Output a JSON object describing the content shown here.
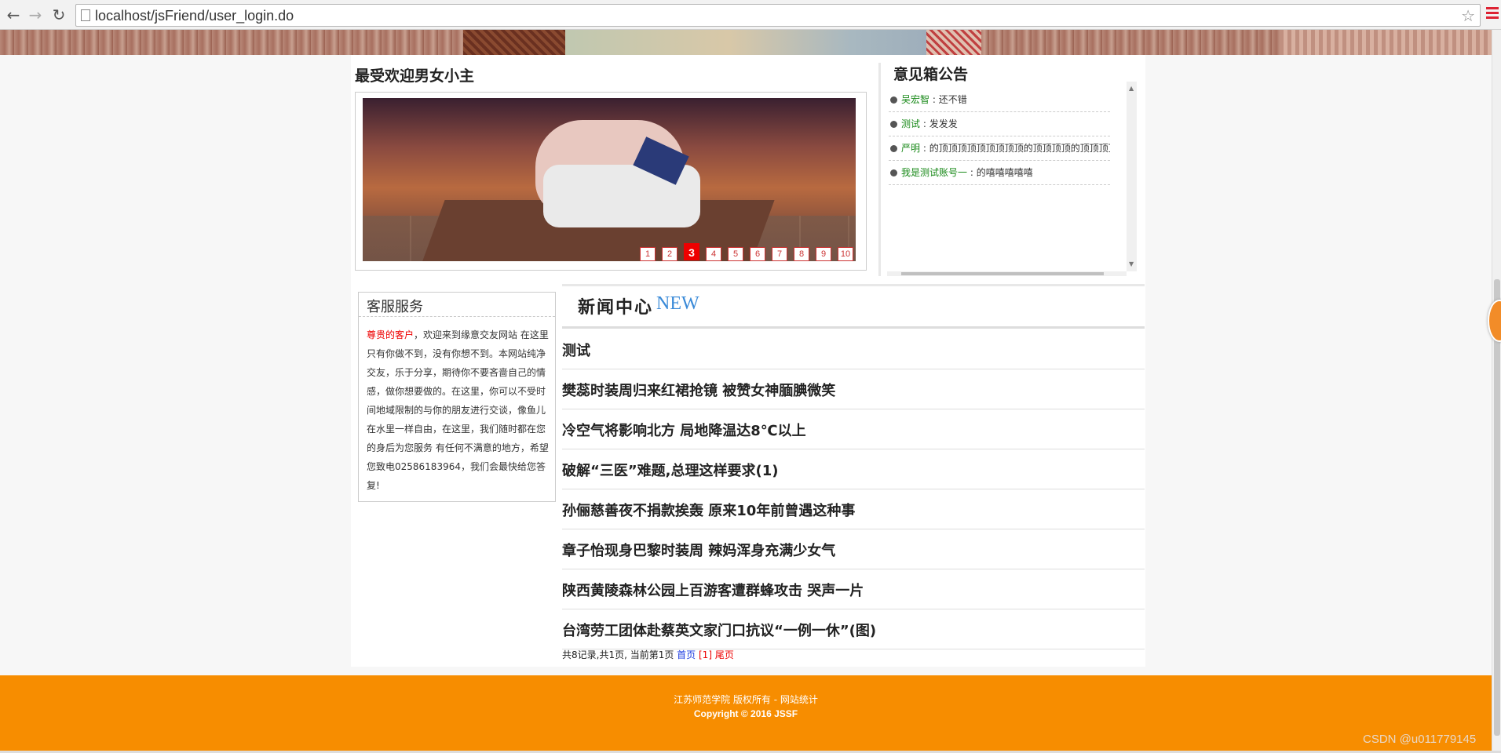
{
  "browser": {
    "url": "localhost/jsFriend/user_login.do"
  },
  "hot": {
    "title": "最受欢迎男女小主",
    "pages": [
      "1",
      "2",
      "3",
      "4",
      "5",
      "6",
      "7",
      "8",
      "9",
      "10"
    ],
    "active_page": "3"
  },
  "notice": {
    "title": "意见箱公告",
    "items": [
      {
        "user": "吴宏智",
        "text": " : 还不错"
      },
      {
        "user": "测试",
        "text": " : 发发发"
      },
      {
        "user": "严明",
        "text": " : 的顶顶顶顶顶顶顶顶顶的顶顶顶顶的顶顶顶顶顶顶顶"
      },
      {
        "user": "我是测试账号一",
        "text": " : 的嘻嘻嘻嘻嘻"
      }
    ]
  },
  "service": {
    "title": "客服服务",
    "highlight": "尊贵的客户",
    "body": "，欢迎来到缘意交友网站 在这里只有你做不到，没有你想不到。本网站纯净交友，乐于分享，期待你不要吝啬自己的情感，做你想要做的。在这里，你可以不受时间地域限制的与你的朋友进行交谈，像鱼儿在水里一样自由，在这里，我们随时都在您的身后为您服务 有任何不满意的地方，希望您致电02586183964，我们会最快给您答复!"
  },
  "news": {
    "title": "新闻中心",
    "badge": "NEW",
    "items": [
      "测试",
      "樊蕊时装周归来红裙抢镜 被赞女神腼腆微笑",
      "冷空气将影响北方 局地降温达8℃以上",
      "破解“三医”难题,总理这样要求(1)",
      "孙俪慈善夜不捐款挨轰 原来10年前曾遇这种事",
      "章子怡现身巴黎时装周 辣妈浑身充满少女气",
      "陕西黄陵森林公园上百游客遭群蜂攻击 哭声一片",
      "台湾劳工团体赴蔡英文家门口抗议“一例一休”(图)"
    ],
    "pager": {
      "summary": "共8记录,共1页, 当前第1页 ",
      "first": "首页",
      "current": " [1] ",
      "last": "尾页"
    }
  },
  "footer": {
    "line1": "江苏师范学院 版权所有 - 网站统计",
    "line2": "Copyright © 2016 JSSF"
  },
  "watermark": "CSDN @u011779145",
  "icons": {
    "back": "arrow-left",
    "forward": "arrow-right",
    "reload": "reload",
    "bookmark": "star",
    "menu": "hamburger"
  }
}
